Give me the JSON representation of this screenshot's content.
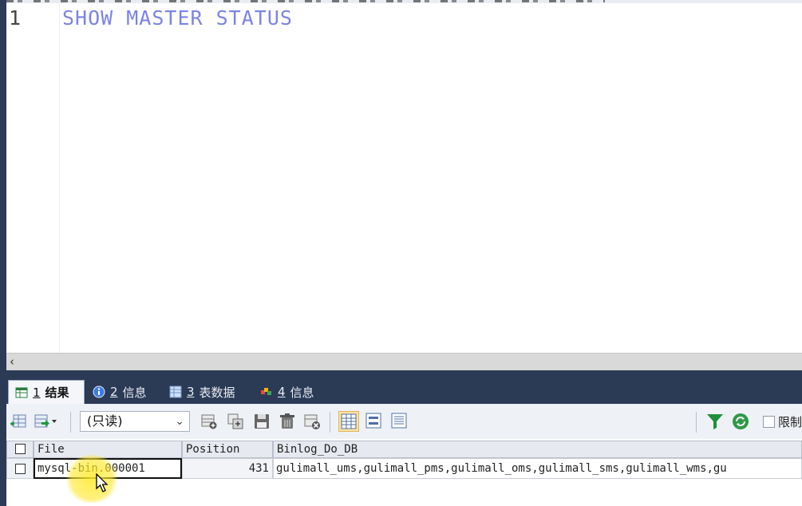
{
  "editor": {
    "line_number": "1",
    "query": "SHOW MASTER STATUS"
  },
  "results": {
    "tabs": [
      {
        "num": "1",
        "label": "结果",
        "icon": "result-grid-icon"
      },
      {
        "num": "2",
        "label": "信息",
        "icon": "info-icon"
      },
      {
        "num": "3",
        "label": "表数据",
        "icon": "table-data-icon"
      },
      {
        "num": "4",
        "label": "信息",
        "icon": "info-color-icon"
      }
    ],
    "toolbar": {
      "readonly_select": "(只读)",
      "limit_label": "限制"
    },
    "columns": [
      "File",
      "Position",
      "Binlog_Do_DB"
    ],
    "rows": [
      {
        "file": "mysql-bin.000001",
        "position": "431",
        "binlog_do_db": "gulimall_ums,gulimall_pms,gulimall_oms,gulimall_sms,gulimall_wms,gu"
      }
    ]
  },
  "colors": {
    "keyword": "#7b83e6",
    "panel_dark": "#2b3a55",
    "active_view": "#fde3a3",
    "click_highlight": "#ffeb28"
  }
}
